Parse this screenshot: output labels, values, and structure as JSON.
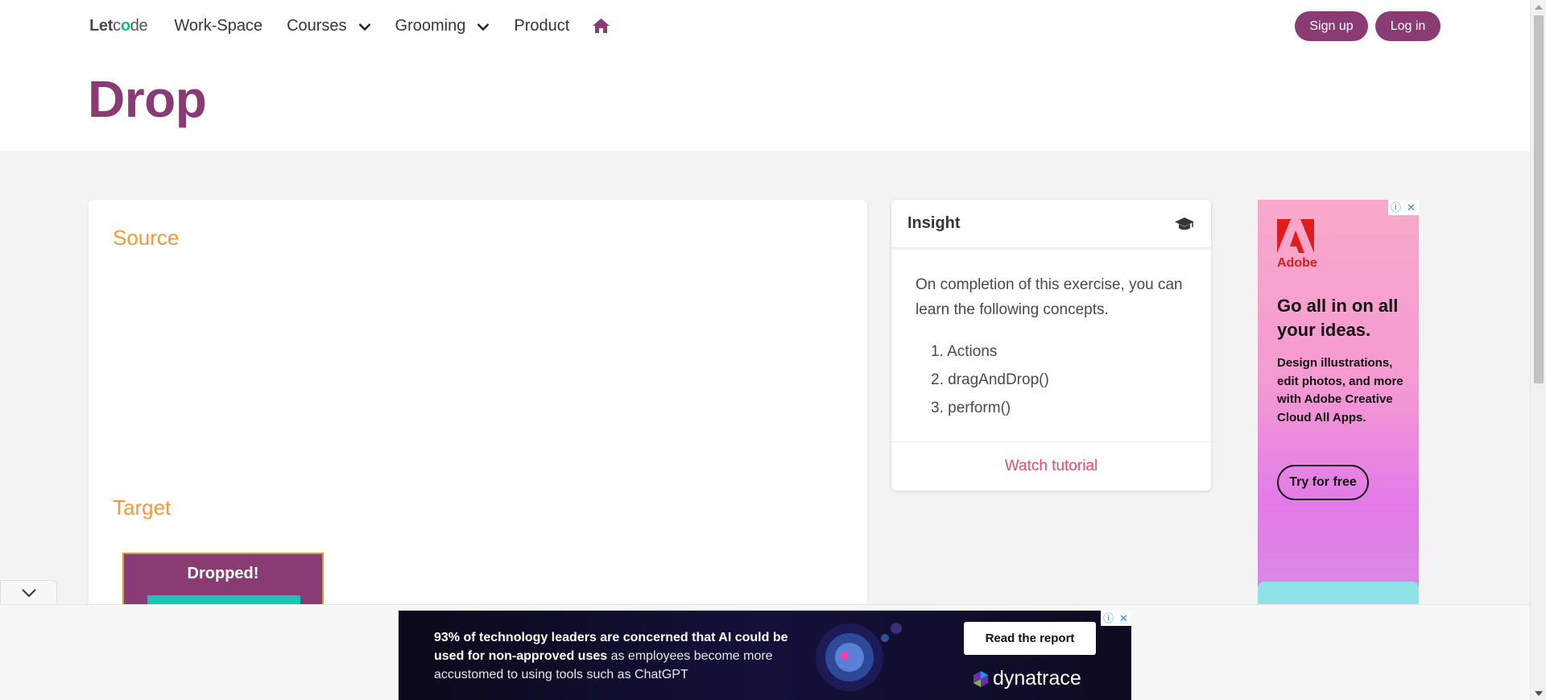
{
  "header": {
    "logo": {
      "let": "Let",
      "c": "c",
      "o": "o",
      "de": "de"
    },
    "nav": {
      "workspace": "Work-Space",
      "courses": "Courses",
      "grooming": "Grooming",
      "product": "Product"
    },
    "signup_label": "Sign up",
    "login_label": "Log in",
    "page_title": "Drop"
  },
  "main": {
    "source_title": "Source",
    "target_title": "Target",
    "drop_label": "Dropped!"
  },
  "insight": {
    "title": "Insight",
    "body": "On completion of this exercise, you can learn the following concepts.",
    "items": [
      "1. Actions",
      "2. dragAndDrop()",
      "3. perform()"
    ],
    "tutorial_link": "Watch tutorial"
  },
  "ad_side": {
    "brand": "Adobe",
    "headline": "Go all in on all your ideas.",
    "body": "Design illustrations, edit photos, and more with Adobe Creative Cloud All Apps.",
    "cta": "Try for free"
  },
  "ad_bottom": {
    "text_bold": "93% of technology leaders are concerned that AI could be used for non-approved uses",
    "text_rest": " as employees become more accustomed to using tools such as ChatGPT",
    "cta": "Read the report",
    "brand": "dynatrace"
  },
  "ad_controls": {
    "info": "ⓘ",
    "close": "✕"
  },
  "colors": {
    "brand_purple": "#8b3b74",
    "section_orange": "#f29a3c",
    "link_red": "#f14668",
    "drop_inner_teal": "#17c7b2"
  },
  "icons": {
    "nav_home": "home-icon",
    "insight": "graduation-cap-icon",
    "collapse": "chevron-down-icon"
  }
}
